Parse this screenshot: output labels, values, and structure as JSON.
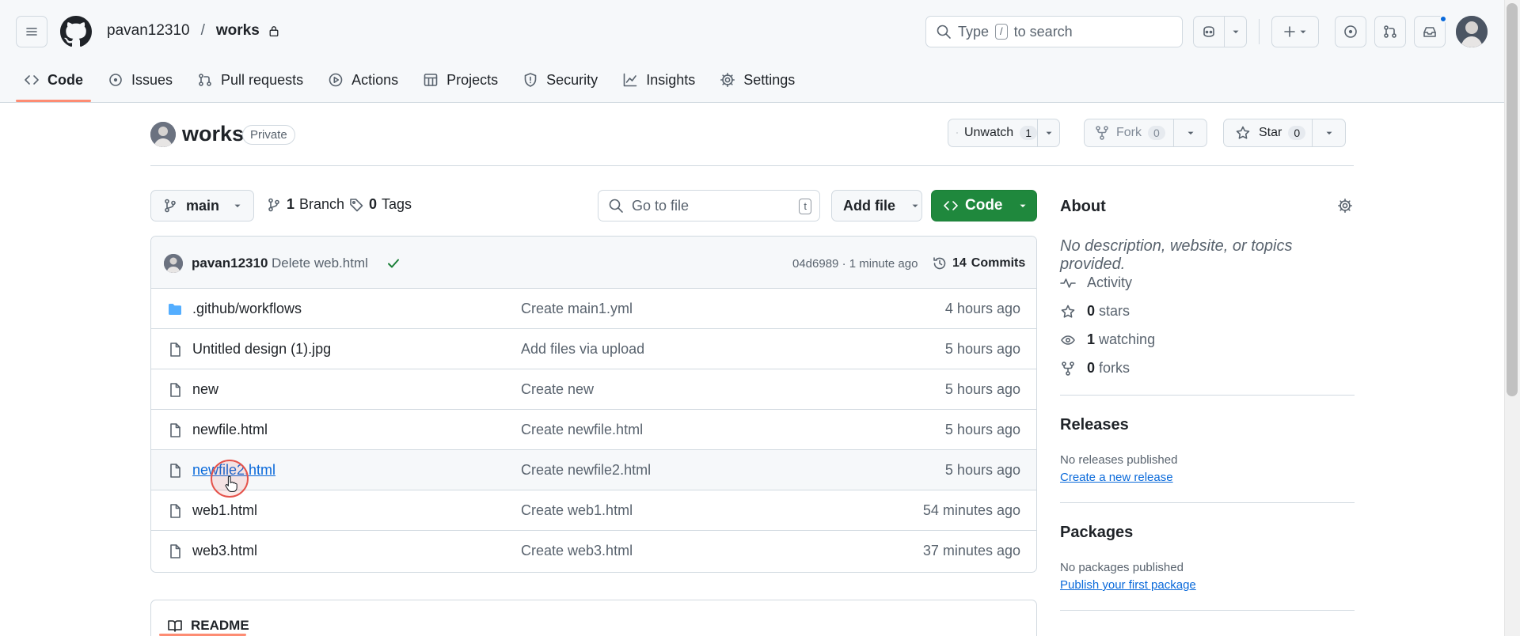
{
  "header": {
    "owner": "pavan12310",
    "separator": "/",
    "repo": "works",
    "search_placeholder_pre": "Type",
    "search_key": "/",
    "search_placeholder_post": "to search"
  },
  "tabs": [
    {
      "label": "Code",
      "icon": "code-icon",
      "selected": true
    },
    {
      "label": "Issues",
      "icon": "issue-icon"
    },
    {
      "label": "Pull requests",
      "icon": "pull-request-icon"
    },
    {
      "label": "Actions",
      "icon": "play-icon"
    },
    {
      "label": "Projects",
      "icon": "table-icon"
    },
    {
      "label": "Security",
      "icon": "shield-icon"
    },
    {
      "label": "Insights",
      "icon": "graph-icon"
    },
    {
      "label": "Settings",
      "icon": "gear-icon"
    }
  ],
  "repo_header": {
    "name": "works",
    "visibility": "Private",
    "unwatch_label": "Unwatch",
    "watch_count": "1",
    "fork_label": "Fork",
    "fork_count": "0",
    "star_label": "Star",
    "star_count": "0"
  },
  "controls": {
    "branch": "main",
    "branches_count": "1",
    "branches_label": "Branch",
    "tags_count": "0",
    "tags_label": "Tags",
    "goto_placeholder": "Go to file",
    "goto_key": "t",
    "add_file_label": "Add file",
    "code_label": "Code"
  },
  "latest_commit": {
    "user": "pavan12310",
    "message": "Delete web.html",
    "meta": "04d6989 · 1 minute ago",
    "commits_count": "14",
    "commits_label": "Commits"
  },
  "files": [
    {
      "name": ".github/workflows",
      "type": "folder",
      "message": "Create main1.yml",
      "time": "4 hours ago"
    },
    {
      "name": "Untitled design (1).jpg",
      "type": "file",
      "message": "Add files via upload",
      "time": "5 hours ago"
    },
    {
      "name": "new",
      "type": "file",
      "message": "Create new",
      "time": "5 hours ago"
    },
    {
      "name": "newfile.html",
      "type": "file",
      "message": "Create newfile.html",
      "time": "5 hours ago"
    },
    {
      "name": "newfile2.html",
      "type": "file",
      "message": "Create newfile2.html",
      "time": "5 hours ago",
      "hovered": true
    },
    {
      "name": "web1.html",
      "type": "file",
      "message": "Create web1.html",
      "time": "54 minutes ago"
    },
    {
      "name": "web3.html",
      "type": "file",
      "message": "Create web3.html",
      "time": "37 minutes ago"
    }
  ],
  "readme": {
    "label": "README"
  },
  "about": {
    "title": "About",
    "description": "No description, website, or topics provided.",
    "activity_label": "Activity",
    "stars_count": "0",
    "stars_label": "stars",
    "watching_count": "1",
    "watching_label": "watching",
    "forks_count": "0",
    "forks_label": "forks"
  },
  "releases": {
    "title": "Releases",
    "empty_text": "No releases published",
    "create_link": "Create a new release"
  },
  "packages": {
    "title": "Packages",
    "empty_text": "No packages published",
    "publish_link": "Publish your first package"
  },
  "colors": {
    "accent": "#0969da",
    "primary_button": "#1f883d",
    "selected_tab_underline": "#fd8c73",
    "border": "#d1d9e0"
  }
}
